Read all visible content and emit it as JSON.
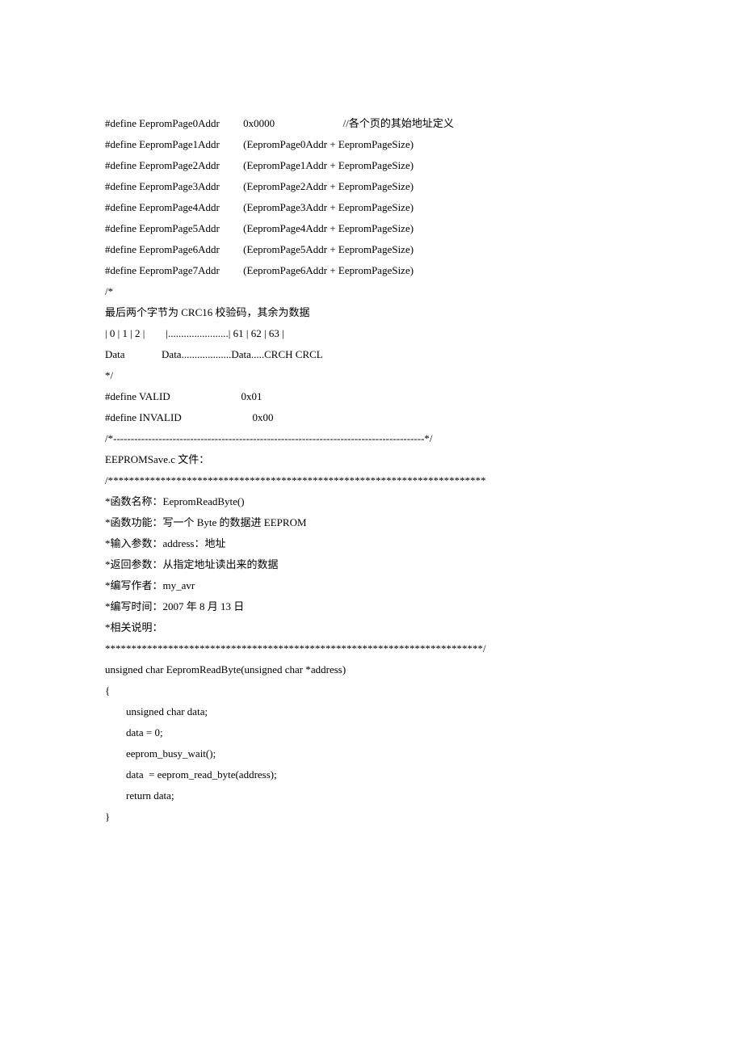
{
  "lines": [
    "#define EepromPage0Addr         0x0000                          //各个页的其始地址定义",
    "#define EepromPage1Addr         (EepromPage0Addr + EepromPageSize)",
    "#define EepromPage2Addr         (EepromPage1Addr + EepromPageSize)",
    "#define EepromPage3Addr         (EepromPage2Addr + EepromPageSize)",
    "#define EepromPage4Addr         (EepromPage3Addr + EepromPageSize)",
    "#define EepromPage5Addr         (EepromPage4Addr + EepromPageSize)",
    "#define EepromPage6Addr         (EepromPage5Addr + EepromPageSize)",
    "#define EepromPage7Addr         (EepromPage6Addr + EepromPageSize)",
    "",
    "/*",
    "最后两个字节为 CRC16 校验码，其余为数据",
    "",
    "| 0 | 1 | 2 |        |.......................| 61 | 62 | 63 |",
    "Data              Data...................Data.....CRCH CRCL",
    "*/",
    "",
    "#define VALID                           0x01",
    "#define INVALID                           0x00",
    "",
    "/*-----------------------------------------------------------------------------------------*/",
    "",
    "EEPROMSave.c 文件：",
    "",
    "/************************************************************************",
    "*函数名称：EepromReadByte()",
    "*函数功能：写一个 Byte 的数据进 EEPROM",
    "*输入参数：address：地址",
    "*返回参数：从指定地址读出来的数据",
    "*编写作者：my_avr",
    "*编写时间：2007 年 8 月 13 日",
    "*相关说明：",
    "************************************************************************/",
    "unsigned char EepromReadByte(unsigned char *address)",
    "{",
    "        unsigned char data;",
    "",
    "        data = 0;",
    "",
    "        eeprom_busy_wait();",
    "        data  = eeprom_read_byte(address);",
    "",
    "        return data;",
    "}"
  ]
}
